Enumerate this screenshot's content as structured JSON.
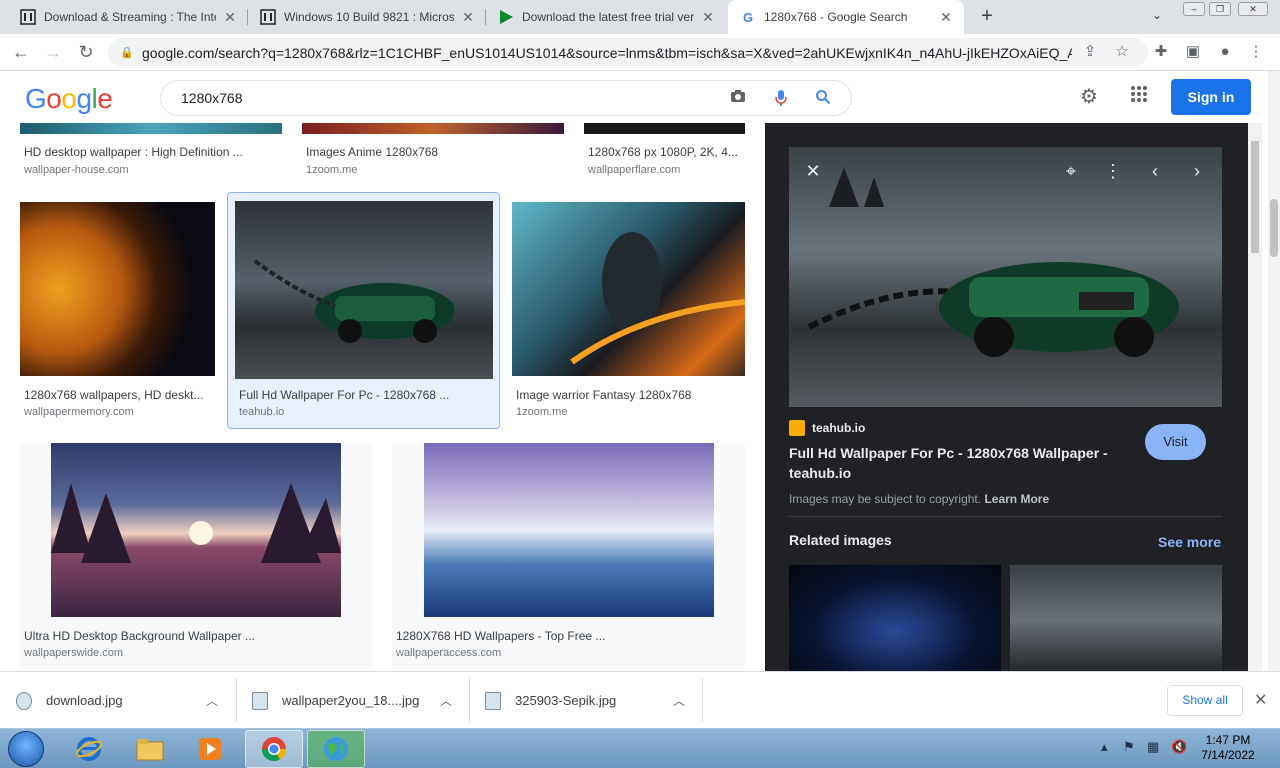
{
  "browser": {
    "tabs": [
      {
        "title": "Download & Streaming : The Inte",
        "close": "✕"
      },
      {
        "title": "Windows 10 Build 9821 : Microso",
        "close": "✕"
      },
      {
        "title": "Download the latest free trial ver",
        "close": "✕"
      },
      {
        "title": "1280x768 - Google Search",
        "close": "✕"
      }
    ],
    "new_tab": "+",
    "url": "google.com/search?q=1280x768&rlz=1C1CHBF_enUS1014US1014&source=lnms&tbm=isch&sa=X&ved=2ahUKEwjxnIK4n_n4AhU-jIkEHZOxAiEQ_A..."
  },
  "google": {
    "logo": "Google",
    "query": "1280x768",
    "sign_in": "Sign in"
  },
  "results": [
    {
      "title": "HD desktop wallpaper : High Definition ...",
      "source": "wallpaper-house.com"
    },
    {
      "title": "Images Anime 1280x768",
      "source": "1zoom.me"
    },
    {
      "title": "1280x768 px 1080P, 2K, 4...",
      "source": "wallpaperflare.com"
    },
    {
      "title": "1280x768 wallpapers, HD deskt...",
      "source": "wallpapermemory.com"
    },
    {
      "title": "Full Hd Wallpaper For Pc - 1280x768 ...",
      "source": "teahub.io"
    },
    {
      "title": "Image warrior Fantasy 1280x768",
      "source": "1zoom.me"
    },
    {
      "title": "Ultra HD Desktop Background Wallpaper ...",
      "source": "wallpaperswide.com"
    },
    {
      "title": "1280X768 HD Wallpapers - Top Free ...",
      "source": "wallpaperaccess.com"
    }
  ],
  "preview": {
    "site": "teahub.io",
    "title": "Full Hd Wallpaper For Pc - 1280x768 Wallpaper - teahub.io",
    "visit": "Visit",
    "copyright": "Images may be subject to copyright.",
    "learn_more": "Learn More",
    "related": "Related images",
    "see_more": "See more"
  },
  "downloads": {
    "items": [
      "download.jpg",
      "wallpaper2you_18....jpg",
      "325903-Sepik.jpg"
    ],
    "show_all": "Show all"
  },
  "taskbar": {
    "time": "1:47 PM",
    "date": "7/14/2022"
  }
}
